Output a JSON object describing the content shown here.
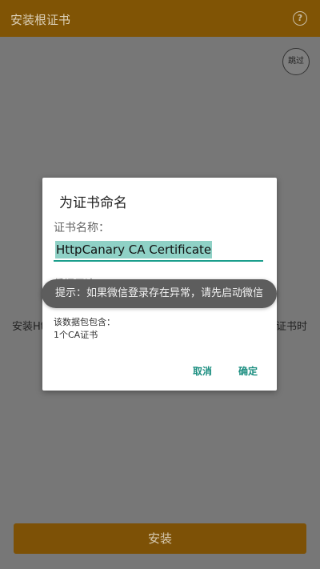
{
  "header": {
    "title": "安装根证书",
    "help_icon": "?"
  },
  "skip_button": {
    "label": "跳过"
  },
  "background": {
    "left_text": "安装Ht",
    "right_text": "证书时"
  },
  "install_button": {
    "label": "安装"
  },
  "dialog": {
    "title": "为证书命名",
    "name_label": "证书名称：",
    "name_value": "HttpCanary CA Certificate",
    "usage_label": "凭据用途：",
    "contains_label": "该数据包包含：",
    "contains_value": "1个CA证书",
    "cancel_label": "取消",
    "ok_label": "确定"
  },
  "toast": {
    "text": "提示：如果微信登录存在异常，请先启动微信"
  },
  "colors": {
    "accent": "#1b9e8c",
    "toolbar": "#805405"
  }
}
